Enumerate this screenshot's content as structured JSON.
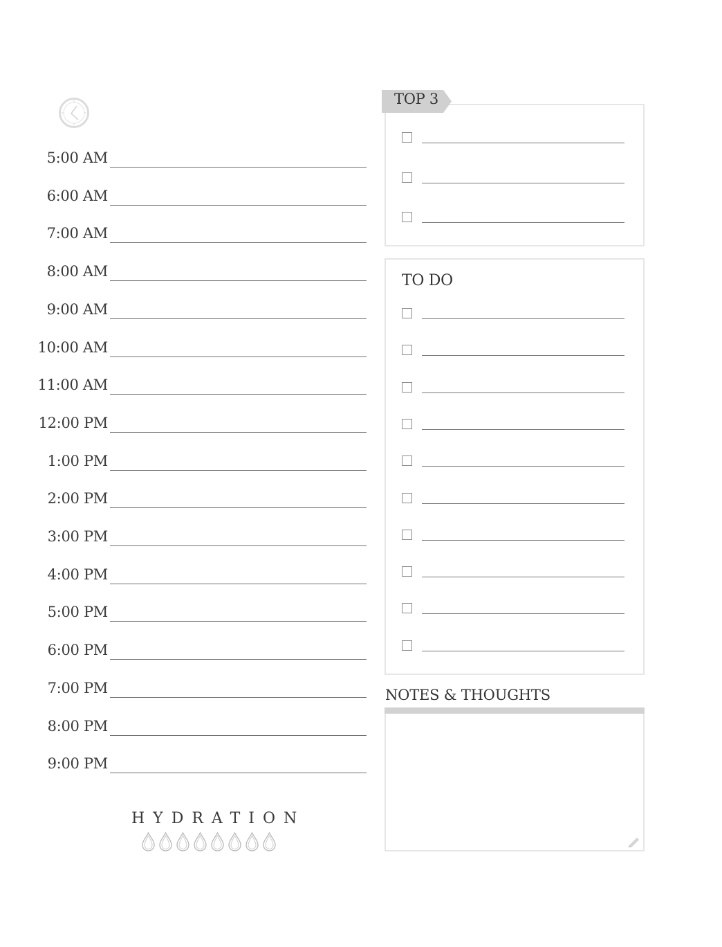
{
  "schedule": {
    "times": [
      "5:00 AM",
      "6:00 AM",
      "7:00 AM",
      "8:00 AM",
      "9:00 AM",
      "10:00 AM",
      "11:00 AM",
      "12:00 PM",
      "1:00 PM",
      "2:00 PM",
      "3:00 PM",
      "4:00 PM",
      "5:00 PM",
      "6:00 PM",
      "7:00 PM",
      "8:00 PM",
      "9:00 PM"
    ]
  },
  "hydration": {
    "label": "HYDRATION",
    "drop_count": 8
  },
  "top3": {
    "title": "TOP 3",
    "item_count": 3
  },
  "todo": {
    "title": "TO DO",
    "item_count": 10
  },
  "notes": {
    "title": "NOTES & THOUGHTS"
  },
  "icons": {
    "clock": "clock-icon",
    "drop": "water-drop-icon",
    "pencil": "pencil-icon"
  },
  "colors": {
    "tab_gray": "#d0d0d0",
    "border_gray": "#e6e6e6",
    "icon_gray": "#d9d9d9",
    "text": "#333333"
  }
}
